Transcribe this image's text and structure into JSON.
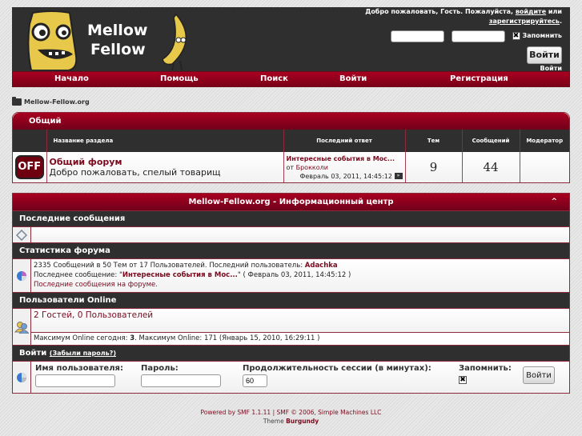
{
  "header": {
    "logo_text_line1": "Mellow",
    "logo_text_line2": "Fellow",
    "welcome_prefix": "Добро пожаловать, Гость. Пожалуйста,",
    "login_link": "войдите",
    "welcome_or": "или",
    "register_link": "зарегистрируйтесь",
    "remember_label": "Запомнить",
    "remember_checked": "✖",
    "login_button": "Войти",
    "login_small": "Войти"
  },
  "nav": {
    "items": [
      {
        "label": "Начало"
      },
      {
        "label": "Помощь"
      },
      {
        "label": "Поиск"
      },
      {
        "label": "Войти"
      },
      {
        "label": "Регистрация"
      }
    ]
  },
  "breadcrumb": {
    "label": "Mellow-Fellow.org"
  },
  "category": {
    "title": "Общий",
    "columns": [
      "Название раздела",
      "Последний ответ",
      "Тем",
      "Сообщений",
      "Модератор"
    ],
    "boards": [
      {
        "status_icon": "OFF",
        "name": "Общий форум",
        "description": "Добро пожаловать, спелый товарищ",
        "last_post_title": "Интересные события в Мос...",
        "last_post_by_prefix": "от",
        "last_post_author": "Брокколи",
        "last_post_date": "Февраль 03, 2011, 14:45:12",
        "topics": "9",
        "posts": "44",
        "moderator": ""
      }
    ]
  },
  "info_center": {
    "title": "Mellow-Fellow.org - Информационный центр",
    "collapse_icon": "^",
    "recent": {
      "heading": "Последние сообщения"
    },
    "stats": {
      "heading": "Статистика форума",
      "line1_prefix": "2335 Сообщений в 50 Тем от 17 Пользователей. Последний пользователь:",
      "latest_member": "Adachka",
      "line2_prefix": "Последнее сообщение:",
      "latest_post": "Интересные события в Мос...",
      "line2_suffix": "( Февраль 03, 2011, 14:45:12 )",
      "recent_link": "Последние сообщения на форуме."
    },
    "online": {
      "heading": "Пользователи Online",
      "summary": "2 Гостей, 0 Пользователей",
      "max_prefix": "Максимум Online сегодня:",
      "max_today": "3",
      "max_suffix": ". Максимум Online: 171 (Январь 15, 2010, 16:29:11 )"
    },
    "login": {
      "heading": "Войти",
      "forgot_link": "(Забыли пароль?)",
      "username_label": "Имя пользователя:",
      "username_value": "",
      "password_label": "Пароль:",
      "password_value": "",
      "session_label": "Продолжительность сессии (в минутах):",
      "session_value": "60",
      "remember_label": "Запомнить:",
      "remember_checked": "✖",
      "login_button": "Войти"
    }
  },
  "footer": {
    "powered": "Powered by SMF 1.1.11 | SMF © 2006, Simple Machines LLC",
    "theme_prefix": "Theme",
    "theme_name": "Burgundy"
  }
}
